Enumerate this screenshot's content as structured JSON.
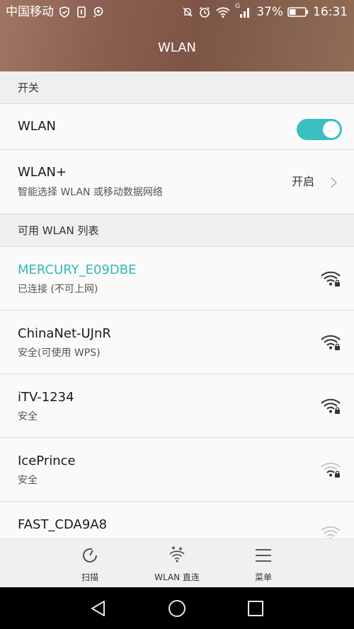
{
  "status_bar": {
    "carrier": "中国移动",
    "battery_percent": "37%",
    "time": "16:31",
    "signal_type": "G",
    "icons_left": [
      "shield-icon",
      "sim-card-icon",
      "location-icon"
    ],
    "icons_right": [
      "notifications-muted-icon",
      "alarm-icon",
      "wifi-signal-icon",
      "cell-signal-icon",
      "battery-icon"
    ]
  },
  "header": {
    "title": "WLAN"
  },
  "switch_section": {
    "header": "开关",
    "wlan": {
      "label": "WLAN",
      "enabled": true
    },
    "wlan_plus": {
      "label": "WLAN+",
      "description": "智能选择 WLAN 或移动数据网络",
      "value": "开启"
    }
  },
  "networks_section": {
    "header": "可用 WLAN 列表",
    "networks": [
      {
        "name": "MERCURY_E09DBE",
        "status": "已连接 (不可上网)",
        "connected": true,
        "signal": "full"
      },
      {
        "name": "ChinaNet-UJnR",
        "status": "安全(可使用 WPS)",
        "connected": false,
        "signal": "full"
      },
      {
        "name": "iTV-1234",
        "status": "安全",
        "connected": false,
        "signal": "full"
      },
      {
        "name": "IcePrince",
        "status": "安全",
        "connected": false,
        "signal": "weak"
      },
      {
        "name": "FAST_CDA9A8",
        "status": "",
        "connected": false,
        "signal": "weak"
      }
    ]
  },
  "toolbar": {
    "scan_label": "扫描",
    "direct_label": "WLAN 直连",
    "menu_label": "菜单"
  },
  "colors": {
    "accent": "#3bbfc0",
    "connected_text": "#35b7b8",
    "header_bg": "#8a5f50"
  }
}
